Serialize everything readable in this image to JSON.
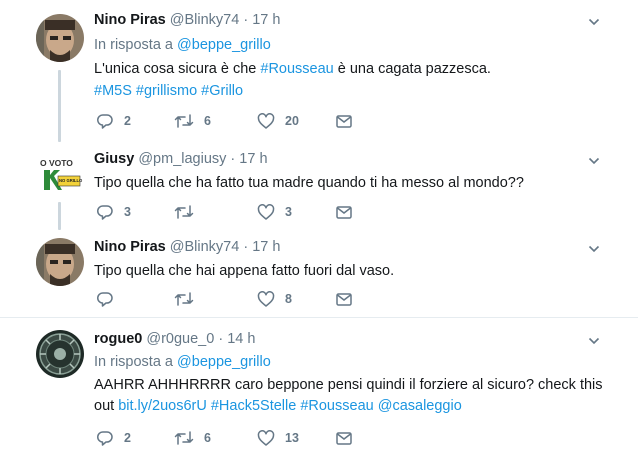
{
  "tweets": [
    {
      "name": "Nino Piras",
      "handle": "@Blinky74",
      "dot": "·",
      "time": "17 h",
      "reply_prefix": "In risposta a",
      "reply_mention": "@beppe_grillo",
      "text_a": "L'unica cosa sicura è che ",
      "text_tag": "#Rousseau",
      "text_b": " è una cagata pazzesca.",
      "tags_line": "#M5S #grillismo #Grillo",
      "replies": "2",
      "retweets": "6",
      "likes": "20"
    },
    {
      "name": "Giusy",
      "handle": "@pm_lagiusy",
      "dot": "·",
      "time": "17 h",
      "avatar_text_top": "O VOTO",
      "avatar_text_badge": "NO GRILLO",
      "text": "Tipo quella che ha fatto tua madre quando ti ha messo al mondo??",
      "replies": "3",
      "retweets": "",
      "likes": "3"
    },
    {
      "name": "Nino Piras",
      "handle": "@Blinky74",
      "dot": "·",
      "time": "17 h",
      "text": "Tipo quella che hai appena fatto fuori dal vaso.",
      "replies": "",
      "retweets": "",
      "likes": "8"
    },
    {
      "name": "rogue0",
      "handle": "@r0gue_0",
      "dot": "·",
      "time": "14 h",
      "reply_prefix": "In risposta a",
      "reply_mention": "@beppe_grillo",
      "text_line1": "AAHRR AHHHRRRR caro beppone pensi quindi il forziere al sicuro? check this",
      "text_out": "out ",
      "link": "bit.ly/2uos6rU",
      "tags": " #Hack5Stelle #Rousseau ",
      "mention2": "@casaleggio",
      "replies": "2",
      "retweets": "6",
      "likes": "13"
    }
  ],
  "colors": {
    "link": "#1b95e0",
    "muted": "#657786",
    "separator": "#e6ecf0",
    "thread_line": "#ccd6dd"
  },
  "icons": [
    "reply-icon",
    "retweet-icon",
    "like-icon",
    "direct-message-icon",
    "chevron-down-icon"
  ]
}
